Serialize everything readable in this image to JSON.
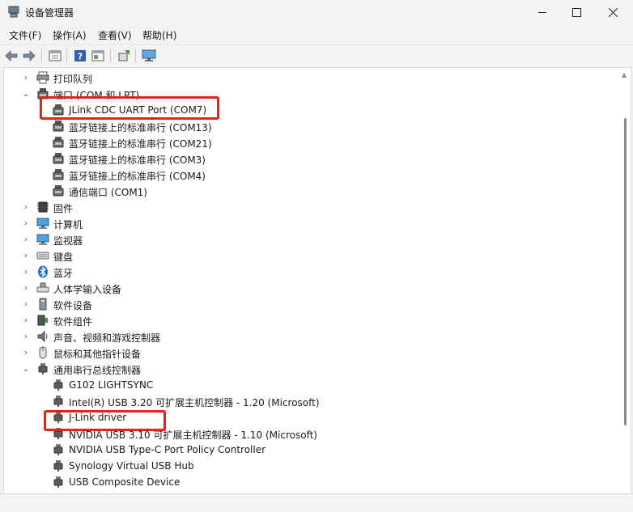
{
  "window": {
    "title": "设备管理器",
    "controls": {
      "minimize": "—",
      "maximize": "☐",
      "close": "✕"
    }
  },
  "menu": [
    "文件(F)",
    "操作(A)",
    "查看(V)",
    "帮助(H)"
  ],
  "toolbar": {
    "buttons": [
      "back-arrow-icon",
      "forward-arrow-icon",
      "properties-icon",
      "help-icon",
      "panel-icon",
      "update-driver-icon",
      "monitor-icon"
    ]
  },
  "tree": [
    {
      "label": "打印队列",
      "level": 0,
      "expander": "›",
      "icon": "printer-icon"
    },
    {
      "label": "端口 (COM 和 LPT)",
      "level": 0,
      "expander": "⌄",
      "icon": "port-icon"
    },
    {
      "label": "JLink CDC UART Port (COM7)",
      "level": 1,
      "expander": "",
      "icon": "port-icon"
    },
    {
      "label": "蓝牙链接上的标准串行 (COM13)",
      "level": 1,
      "expander": "",
      "icon": "port-icon"
    },
    {
      "label": "蓝牙链接上的标准串行 (COM21)",
      "level": 1,
      "expander": "",
      "icon": "port-icon"
    },
    {
      "label": "蓝牙链接上的标准串行 (COM3)",
      "level": 1,
      "expander": "",
      "icon": "port-icon"
    },
    {
      "label": "蓝牙链接上的标准串行 (COM4)",
      "level": 1,
      "expander": "",
      "icon": "port-icon"
    },
    {
      "label": "通信端口 (COM1)",
      "level": 1,
      "expander": "",
      "icon": "port-icon"
    },
    {
      "label": "固件",
      "level": 0,
      "expander": "›",
      "icon": "chip-icon"
    },
    {
      "label": "计算机",
      "level": 0,
      "expander": "›",
      "icon": "computer-icon"
    },
    {
      "label": "监视器",
      "level": 0,
      "expander": "›",
      "icon": "monitor-icon"
    },
    {
      "label": "键盘",
      "level": 0,
      "expander": "›",
      "icon": "keyboard-icon"
    },
    {
      "label": "蓝牙",
      "level": 0,
      "expander": "›",
      "icon": "bluetooth-icon"
    },
    {
      "label": "人体学输入设备",
      "level": 0,
      "expander": "›",
      "icon": "hid-icon"
    },
    {
      "label": "软件设备",
      "level": 0,
      "expander": "›",
      "icon": "software-device-icon"
    },
    {
      "label": "软件组件",
      "level": 0,
      "expander": "›",
      "icon": "software-component-icon"
    },
    {
      "label": "声音、视频和游戏控制器",
      "level": 0,
      "expander": "›",
      "icon": "speaker-icon"
    },
    {
      "label": "鼠标和其他指针设备",
      "level": 0,
      "expander": "›",
      "icon": "mouse-icon"
    },
    {
      "label": "通用串行总线控制器",
      "level": 0,
      "expander": "⌄",
      "icon": "usb-icon"
    },
    {
      "label": "G102 LIGHTSYNC",
      "level": 1,
      "expander": "",
      "icon": "usb-icon"
    },
    {
      "label": "Intel(R) USB 3.20 可扩展主机控制器 - 1.20 (Microsoft)",
      "level": 1,
      "expander": "",
      "icon": "usb-icon"
    },
    {
      "label": "J-Link driver",
      "level": 1,
      "expander": "",
      "icon": "usb-icon"
    },
    {
      "label": "NVIDIA USB 3.10 可扩展主机控制器 - 1.10 (Microsoft)",
      "level": 1,
      "expander": "",
      "icon": "usb-icon"
    },
    {
      "label": "NVIDIA USB Type-C Port Policy Controller",
      "level": 1,
      "expander": "",
      "icon": "usb-icon"
    },
    {
      "label": "Synology Virtual USB Hub",
      "level": 1,
      "expander": "",
      "icon": "usb-icon"
    },
    {
      "label": "USB Composite Device",
      "level": 1,
      "expander": "",
      "icon": "usb-icon"
    }
  ],
  "colors": {
    "highlight_box": "#e0251b",
    "background": "#f3f3f3",
    "content_bg": "#ffffff"
  }
}
